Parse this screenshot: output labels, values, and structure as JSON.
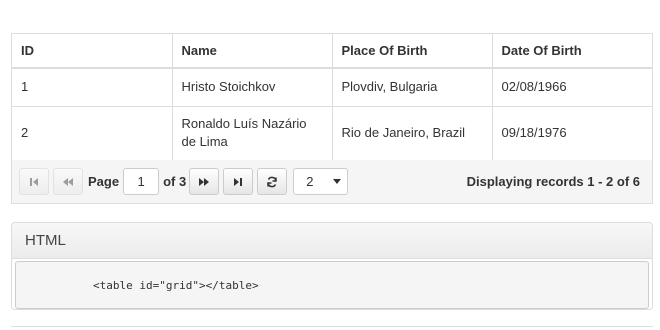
{
  "grid": {
    "columns": [
      "ID",
      "Name",
      "Place Of Birth",
      "Date Of Birth"
    ],
    "rows": [
      {
        "id": "1",
        "name": "Hristo Stoichkov",
        "place": "Plovdiv, Bulgaria",
        "date": "02/08/1966"
      },
      {
        "id": "2",
        "name": "Ronaldo Luís Nazário de Lima",
        "place": "Rio de Janeiro, Brazil",
        "date": "09/18/1976"
      }
    ]
  },
  "pager": {
    "page_label": "Page",
    "current_page": "1",
    "of_label": "of 3",
    "page_size": "2",
    "records_text": "Displaying records 1 - 2 of 6",
    "icons": [
      "first-page-icon",
      "previous-page-icon",
      "next-page-icon",
      "last-page-icon",
      "refresh-icon",
      "chevron-down-icon"
    ]
  },
  "code_panel": {
    "title": "HTML",
    "code": "<table id=\"grid\"></table>"
  }
}
